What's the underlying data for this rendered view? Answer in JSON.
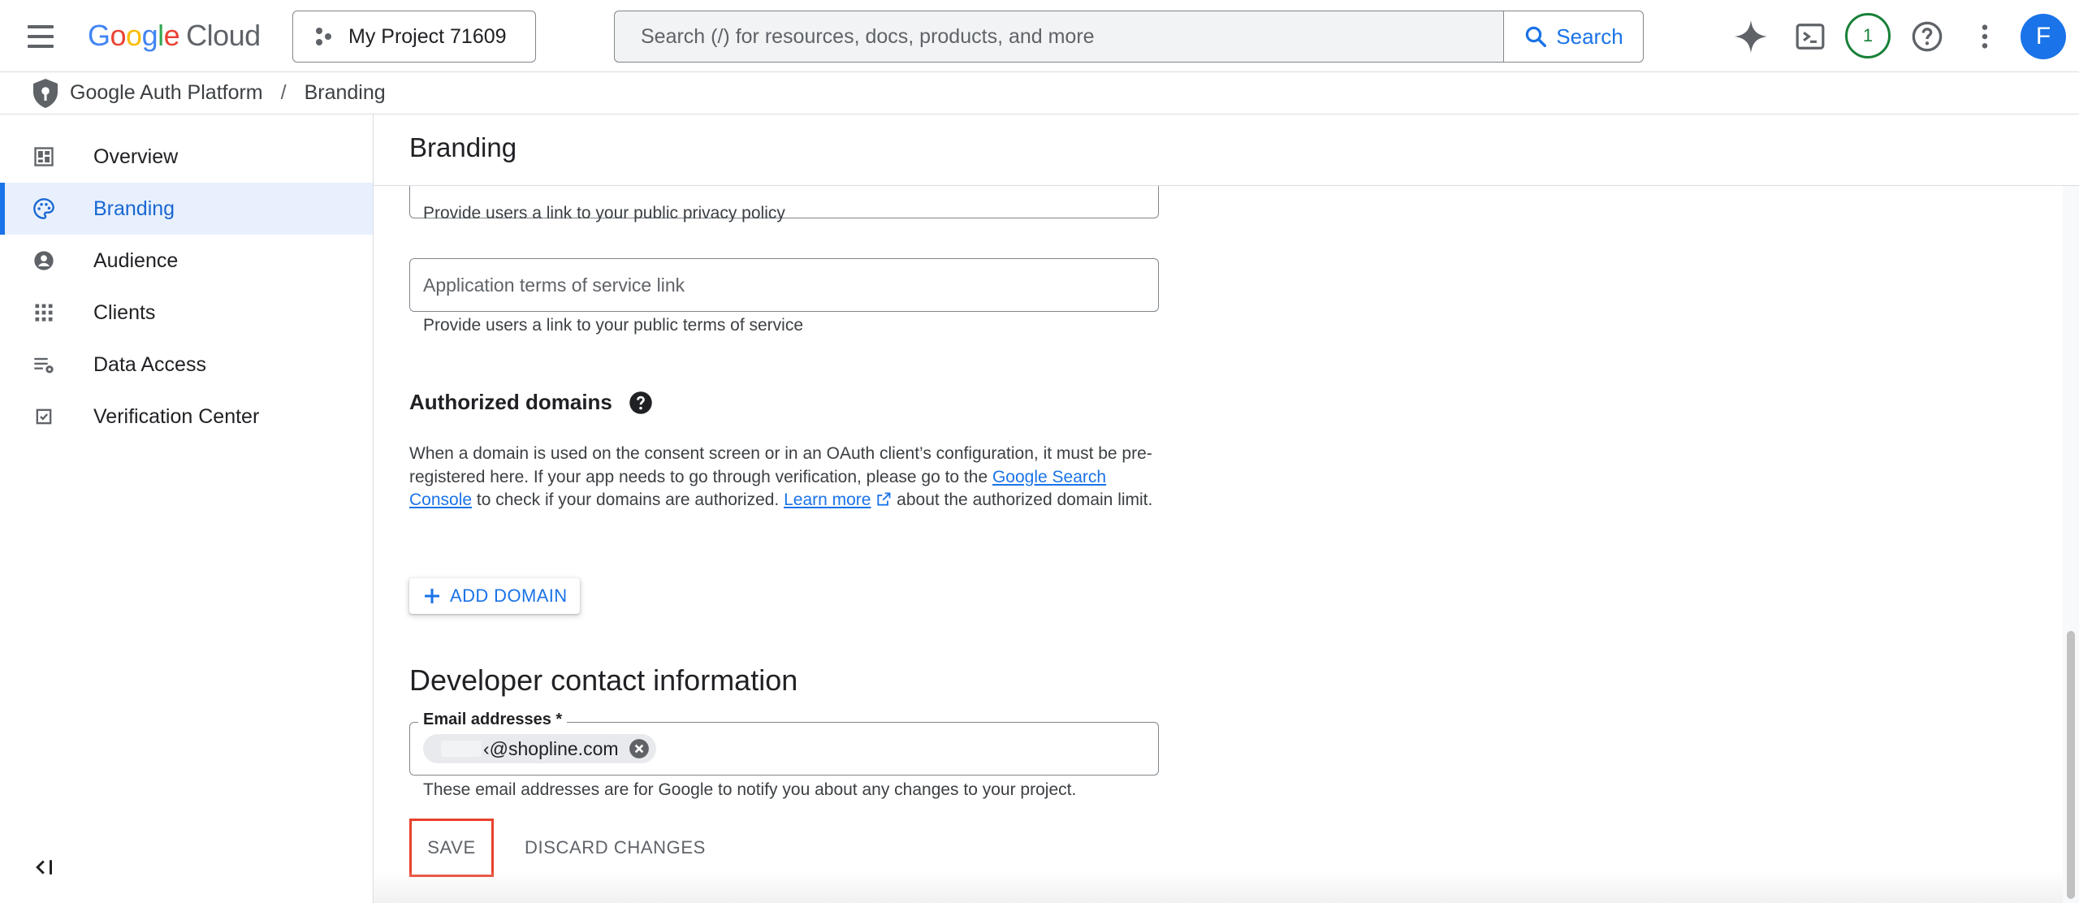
{
  "header": {
    "logo_google": "Google",
    "logo_cloud": "Cloud",
    "project_name": "My Project 71609",
    "search_placeholder": "Search (/) for resources, docs, products, and more",
    "search_button": "Search",
    "notification_count": "1",
    "avatar_initial": "F",
    "icons": [
      "menu-icon",
      "gemini-sparkle-icon",
      "cloud-shell-icon",
      "help-icon",
      "more-vert-icon"
    ]
  },
  "breadcrumb": {
    "root": "Google Auth Platform",
    "separator": "/",
    "current": "Branding"
  },
  "sidebar": {
    "items": [
      {
        "label": "Overview",
        "icon": "dashboard-icon"
      },
      {
        "label": "Branding",
        "icon": "palette-icon",
        "active": true
      },
      {
        "label": "Audience",
        "icon": "account-circle-icon"
      },
      {
        "label": "Clients",
        "icon": "apps-grid-icon"
      },
      {
        "label": "Data Access",
        "icon": "data-settings-icon"
      },
      {
        "label": "Verification Center",
        "icon": "checkbox-icon"
      }
    ]
  },
  "main": {
    "title": "Branding",
    "privacy_helper": "Provide users a link to your public privacy policy",
    "tos_placeholder": "Application terms of service link",
    "tos_helper": "Provide users a link to your public terms of service",
    "authorized_domains": {
      "title": "Authorized domains",
      "desc_1": "When a domain is used on the consent screen or in an OAuth client’s configuration, it must be pre-registered here. If your app needs to go through verification, please go to the ",
      "link_search_console": "Google Search Console",
      "desc_2": " to check if your domains are authorized. ",
      "link_learn_more": "Learn more",
      "desc_3": " about the authorized domain limit.",
      "add_button": "ADD DOMAIN"
    },
    "developer_contact": {
      "title": "Developer contact information",
      "email_label": "Email addresses *",
      "email_chip": "‹@shopline.com",
      "helper": "These email addresses are for Google to notify you about any changes to your project."
    },
    "save_button": "SAVE",
    "discard_button": "DISCARD CHANGES"
  },
  "colors": {
    "accent": "#1a73e8",
    "active_bg": "#e8f0fe",
    "highlight_border": "#e8412c",
    "notification": "#188038"
  }
}
